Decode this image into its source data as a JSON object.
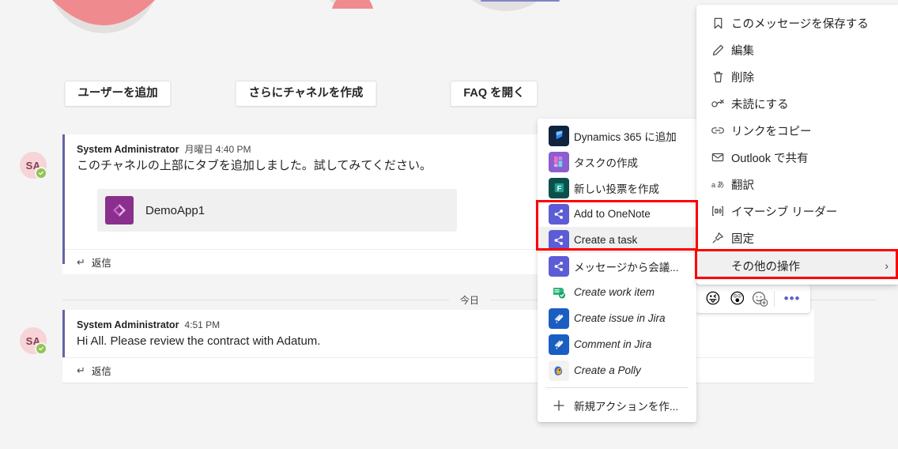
{
  "onboarding": {
    "tiles": [
      {
        "id": "add-users",
        "cta": "ユーザーを追加"
      },
      {
        "id": "create-channels",
        "cta": "さらにチャネルを作成"
      },
      {
        "id": "open-faq",
        "cta": "FAQ を開く"
      }
    ]
  },
  "conversation": {
    "day_divider": "今日",
    "messages": [
      {
        "avatar_initials": "SA",
        "author": "System Administrator",
        "time": "月曜日 4:40 PM",
        "text": "このチャネルの上部にタブを追加しました。試してみてください。",
        "attachment": {
          "app_name": "DemoApp1"
        },
        "reply_label": "返信"
      },
      {
        "avatar_initials": "SA",
        "author": "System Administrator",
        "time": "4:51 PM",
        "text": "Hi All. Please review the contract with Adatum.",
        "reply_label": "返信"
      }
    ]
  },
  "reaction_bar": {
    "emojis": [
      "😜",
      "😲"
    ],
    "add_reaction_icon": "add-reaction-icon",
    "more_label": "•••"
  },
  "menu_main": {
    "items": [
      {
        "label": "このメッセージを保存する",
        "icon": "bookmark-icon"
      },
      {
        "label": "編集",
        "icon": "pencil-icon"
      },
      {
        "label": "削除",
        "icon": "trash-icon"
      },
      {
        "label": "未読にする",
        "icon": "mark-unread-icon"
      },
      {
        "label": "リンクをコピー",
        "icon": "link-icon"
      },
      {
        "label": "Outlook で共有",
        "icon": "envelope-icon"
      },
      {
        "label": "翻訳",
        "icon": "translate-icon"
      },
      {
        "label": "イマーシブ リーダー",
        "icon": "immersive-reader-icon"
      },
      {
        "label": "固定",
        "icon": "pin-icon"
      },
      {
        "label": "その他の操作",
        "icon": "none",
        "chevron": "›",
        "highlighted": true
      }
    ]
  },
  "menu_actions": {
    "items": [
      {
        "label": "Dynamics 365 に追加",
        "icon": "dynamics365-icon",
        "italic": false
      },
      {
        "label": "タスクの作成",
        "icon": "planner-icon",
        "italic": false
      },
      {
        "label": "新しい投票を作成",
        "icon": "forms-icon",
        "italic": false
      },
      {
        "label": "Add to OneNote",
        "icon": "power-automate-icon",
        "italic": false
      },
      {
        "label": "Create a task",
        "icon": "power-automate-icon",
        "italic": false,
        "highlighted": true
      },
      {
        "label": "メッセージから会議...",
        "icon": "power-automate-icon",
        "italic": false
      },
      {
        "label": "Create work item",
        "icon": "azure-devops-icon",
        "italic": true
      },
      {
        "label": "Create issue in Jira",
        "icon": "jira-icon",
        "italic": true
      },
      {
        "label": "Comment in Jira",
        "icon": "jira-icon",
        "italic": true
      },
      {
        "label": "Create a Polly",
        "icon": "polly-icon",
        "italic": true
      }
    ],
    "footer": {
      "label": "新規アクションを作...",
      "icon": "plus-icon"
    }
  },
  "colors": {
    "page_background": "#f4f4f4",
    "message_accent": "#6264a7",
    "highlight_box": "#ff0000",
    "hover_row": "#f0f0f0",
    "presence_available": "#92c353",
    "app_demo_icon": "#8a2f8d",
    "power_automate": "#5c5cd6",
    "jira": "#1b5ec2",
    "azure_devops": "#2eb67d",
    "dynamics365": "#10233f",
    "forms": "#14625c"
  }
}
